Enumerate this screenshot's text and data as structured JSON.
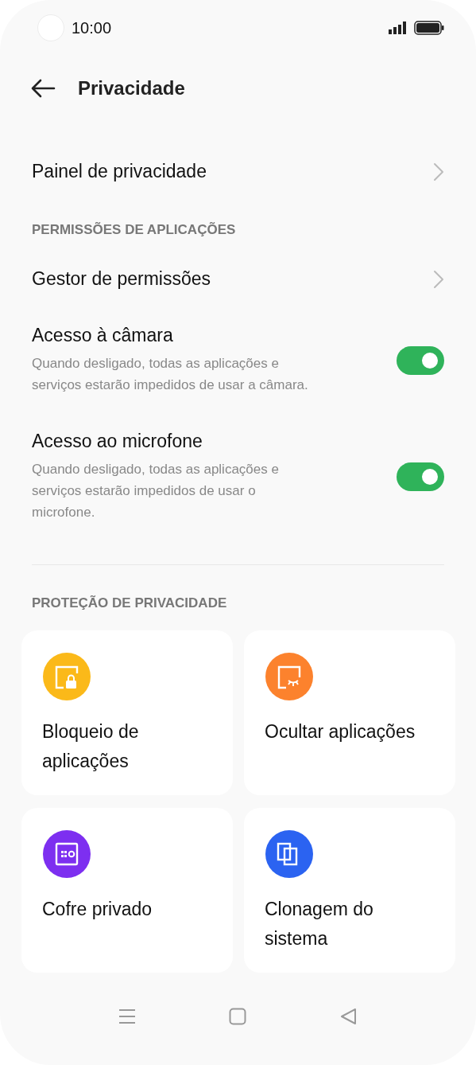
{
  "status_bar": {
    "time": "10:00"
  },
  "header": {
    "title": "Privacidade"
  },
  "sections": [
    {
      "items": [
        {
          "kind": "link",
          "title": "Painel de privacidade"
        }
      ]
    },
    {
      "heading": "PERMISSÕES DE APLICAÇÕES",
      "items": [
        {
          "kind": "link",
          "title": "Gestor de permissões"
        },
        {
          "kind": "toggle",
          "title": "Acesso à câmara",
          "description": "Quando desligado, todas as aplicações e serviços estarão impedidos de usar a câmara.",
          "on": true
        },
        {
          "kind": "toggle",
          "title": "Acesso ao microfone",
          "description": "Quando desligado, todas as aplicações e serviços estarão impedidos de usar o microfone.",
          "on": true
        }
      ]
    }
  ],
  "protection": {
    "heading": "PROTEÇÃO DE PRIVACIDADE",
    "tiles": [
      {
        "label": "Bloqueio de aplicações",
        "kind": "lock",
        "color": "#fbb919"
      },
      {
        "label": "Ocultar aplicações",
        "kind": "hide",
        "color": "#fc822d"
      },
      {
        "label": "Cofre privado",
        "kind": "safe",
        "color": "#7d2ff0"
      },
      {
        "label": "Clonagem do sistema",
        "kind": "clone",
        "color": "#2b63f1"
      }
    ]
  }
}
